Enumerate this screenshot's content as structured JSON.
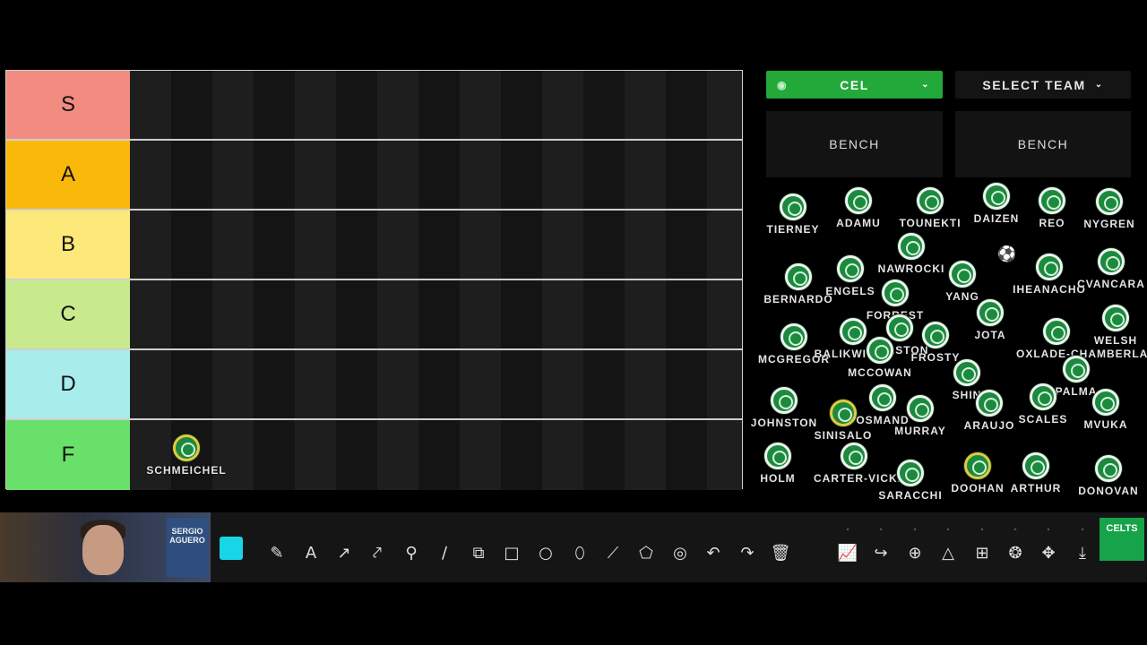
{
  "tiers": [
    {
      "label": "S",
      "color": "#f28b80"
    },
    {
      "label": "A",
      "color": "#f9b90a"
    },
    {
      "label": "B",
      "color": "#fde97a"
    },
    {
      "label": "C",
      "color": "#c8ea8d"
    },
    {
      "label": "D",
      "color": "#a8ecec"
    },
    {
      "label": "F",
      "color": "#68e06a"
    }
  ],
  "tier_f_player": "SCHMEICHEL",
  "controls": {
    "primary_team": "CEL",
    "secondary_team": "SELECT TEAM",
    "bench_left": "BENCH",
    "bench_right": "BENCH"
  },
  "pool_players": [
    "TIERNEY",
    "ADAMU",
    "TOUNEKTI",
    "DAIZEN",
    "REO",
    "NYGREN",
    "NAWROCKI",
    "BERNARDO",
    "ENGELS",
    "YANG",
    "IHEANACHO",
    "CVANCARA",
    "FORREST",
    "JOTA",
    "WELSH",
    "MCGREGOR",
    "BALIKWISHA",
    "RALSTON",
    "FROSTY",
    "OXLADE-CHAMBERLAIN",
    "MCCOWAN",
    "SHIN",
    "PALMA",
    "JOHNSTON",
    "OSMAND",
    "ARAUJO",
    "SCALES",
    "MVUKA",
    "SINISALO",
    "MURRAY",
    "HOLM",
    "CARTER-VICKERS",
    "SARACCHI",
    "DOOHAN",
    "ARTHUR",
    "DONOVAN"
  ],
  "webcam_poster": "SERGIO AGUERO",
  "logo_text": "CELTS",
  "toolbar_icons": [
    "pen-icon",
    "text-icon",
    "arrow-icon",
    "curved-arrow-icon",
    "magnifier-icon",
    "line-icon",
    "resize-icon",
    "rectangle-icon",
    "circle-icon",
    "lasso-icon",
    "polyline-icon",
    "polygon-icon",
    "target-icon",
    "undo-icon",
    "redo-icon",
    "trash-icon",
    "chart-icon",
    "share-icon",
    "zoom-icon",
    "triangle-icon",
    "grid-icon",
    "shirt-icon",
    "move-icon",
    "download-icon"
  ]
}
